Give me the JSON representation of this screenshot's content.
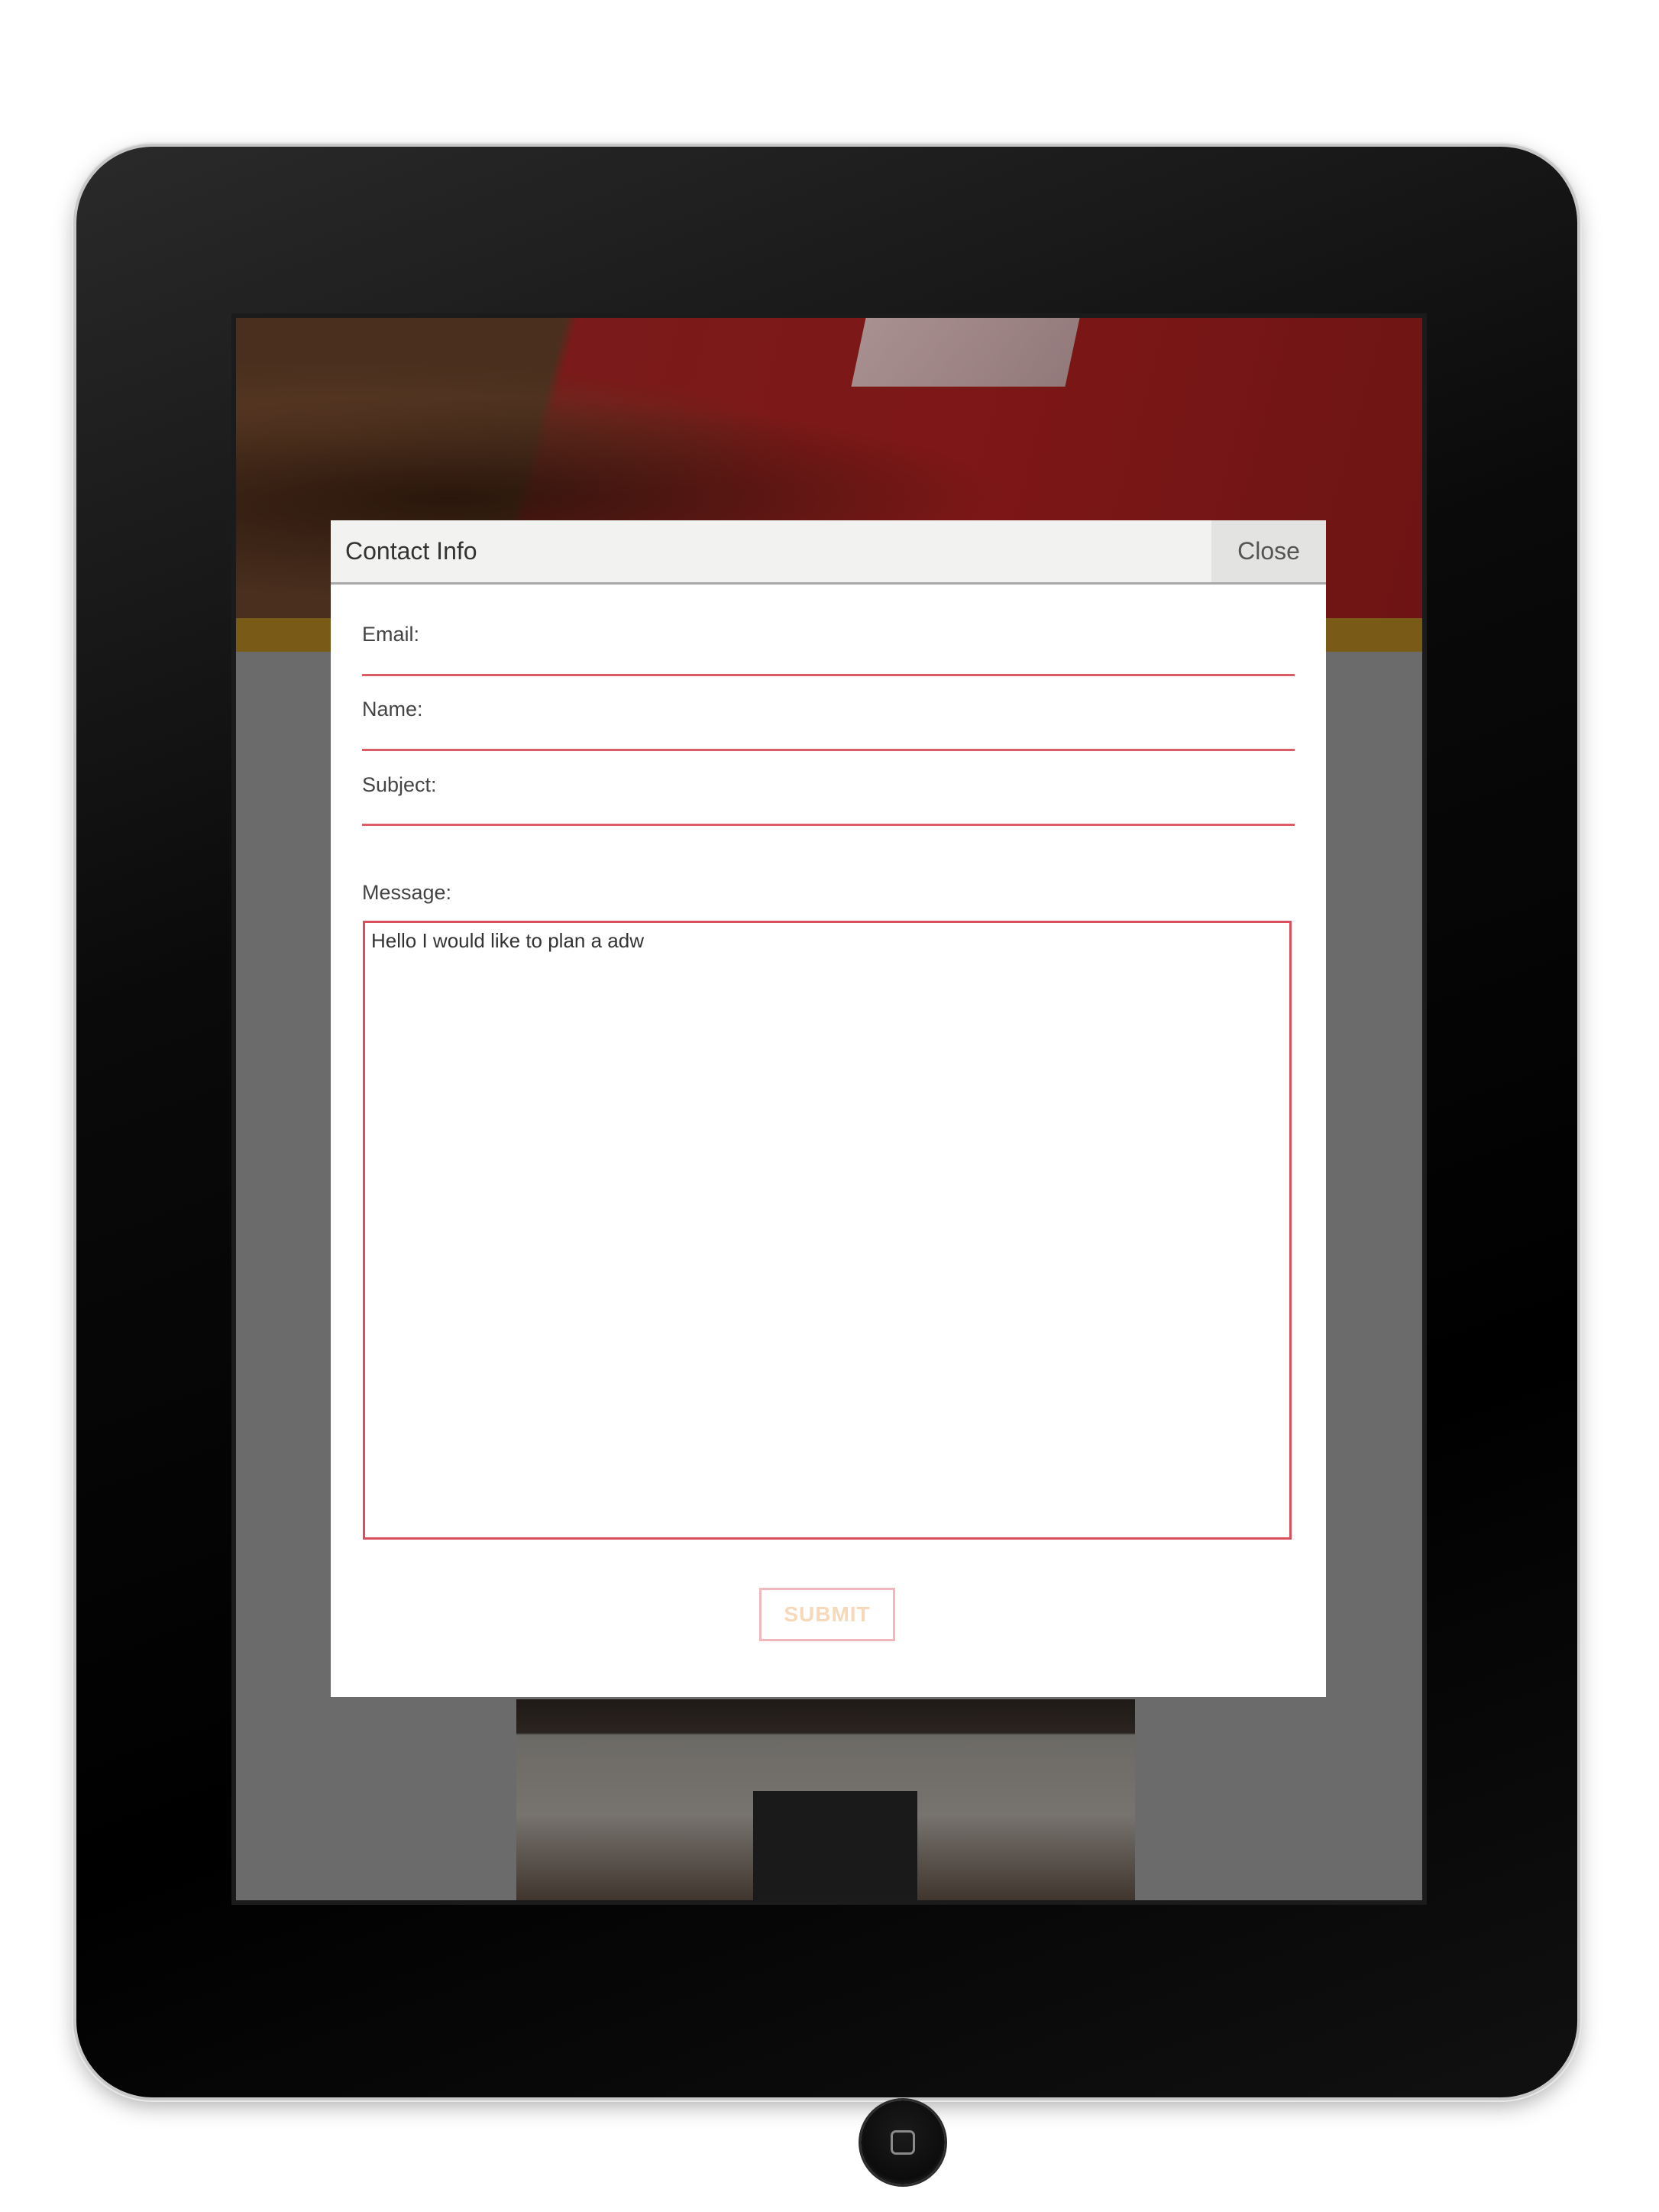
{
  "modal": {
    "title": "Contact Info",
    "close_label": "Close",
    "fields": {
      "email_label": "Email:",
      "email_value": "",
      "name_label": "Name:",
      "name_value": "",
      "subject_label": "Subject:",
      "subject_value": "",
      "message_label": "Message:",
      "message_value": "Hello I would like to plan a adw"
    },
    "submit_label": "SUBMIT"
  },
  "colors": {
    "field_border": "#dd5c66",
    "submit_text": "#f7d8b8",
    "overlay": "#6b6b6b",
    "accent_strip": "#7a5a17"
  },
  "icons": {
    "camera": "camera-icon",
    "home": "home-button-icon"
  }
}
